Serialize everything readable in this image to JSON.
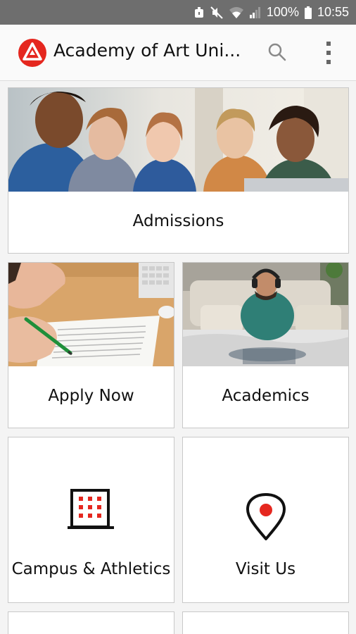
{
  "status_bar": {
    "battery": "100%",
    "time": "10:55",
    "icons": [
      "alarm-icon",
      "mute-icon",
      "wifi-icon",
      "signal-icon",
      "battery-icon"
    ]
  },
  "app_bar": {
    "title": "Academy of Art Uni...",
    "logo_icon": "academy-logo-icon",
    "search_icon": "search-icon",
    "more_icon": "more-vert-icon"
  },
  "colors": {
    "brand_red": "#e5271f",
    "status_bar": "#6e6e6e",
    "card_border": "#c8c8c8"
  },
  "tiles": {
    "admissions": {
      "label": "Admissions"
    },
    "apply_now": {
      "label": "Apply Now"
    },
    "academics": {
      "label": "Academics"
    },
    "campus_athletics": {
      "label": "Campus & Athletics",
      "icon": "building-icon"
    },
    "visit_us": {
      "label": "Visit Us",
      "icon": "location-pin-icon"
    }
  }
}
